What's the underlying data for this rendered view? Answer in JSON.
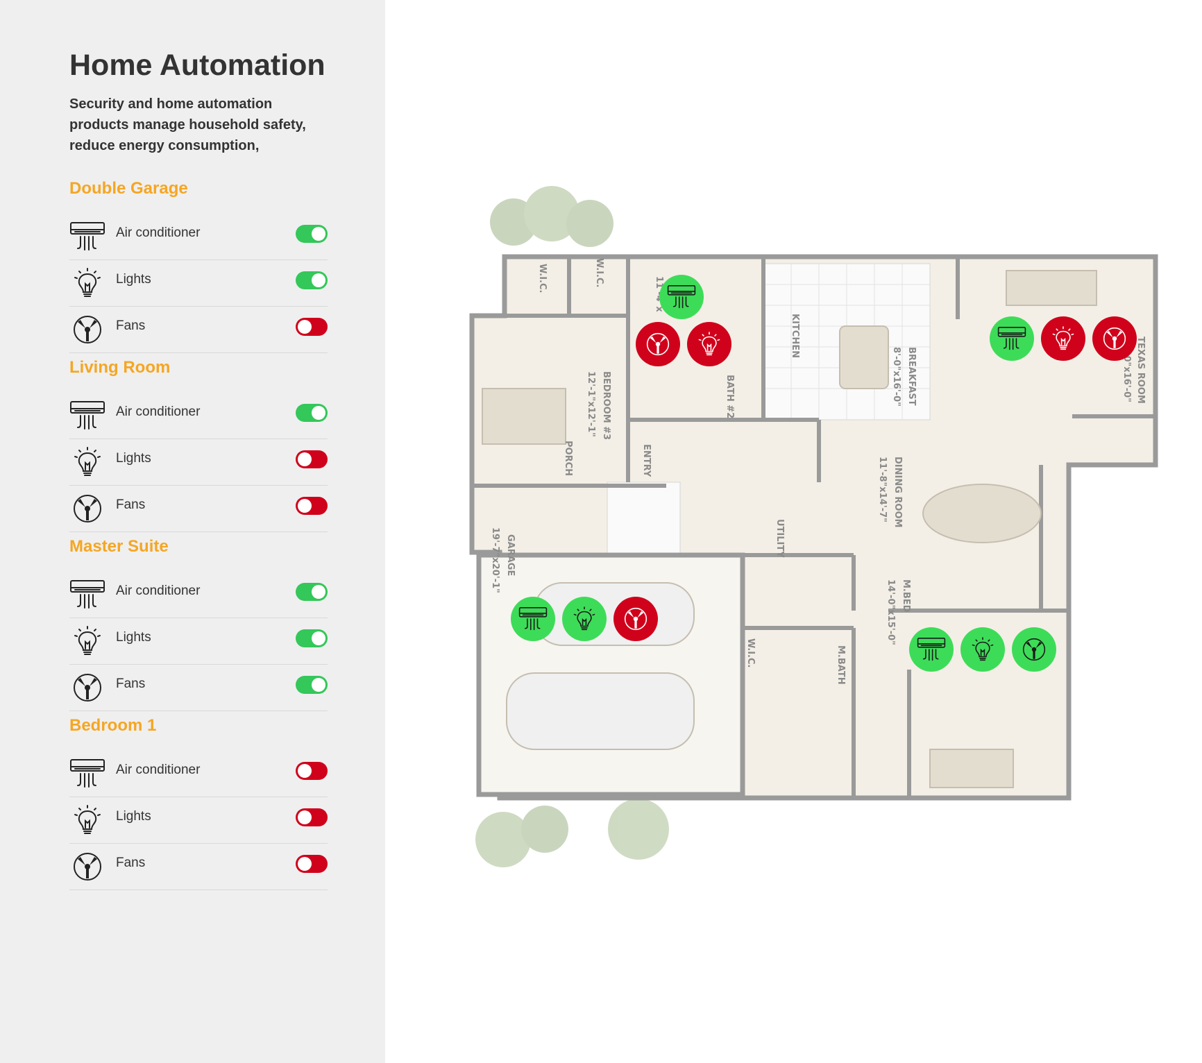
{
  "header": {
    "title": "Home Automation",
    "description": "Security and home automation products manage household safety, reduce energy consumption,"
  },
  "colors": {
    "accent": "#f5a623",
    "on": "#34c759",
    "off": "#d0021b",
    "sidebar_bg": "#efefef"
  },
  "rooms": [
    {
      "name": "Double Garage",
      "devices": [
        {
          "icon": "air-conditioner-icon",
          "label": "Air conditioner",
          "on": true
        },
        {
          "icon": "bulb-icon",
          "label": "Lights",
          "on": true
        },
        {
          "icon": "fan-icon",
          "label": "Fans",
          "on": false
        }
      ]
    },
    {
      "name": "Living Room",
      "devices": [
        {
          "icon": "air-conditioner-icon",
          "label": "Air conditioner",
          "on": true
        },
        {
          "icon": "bulb-icon",
          "label": "Lights",
          "on": false
        },
        {
          "icon": "fan-icon",
          "label": "Fans",
          "on": false
        }
      ]
    },
    {
      "name": "Master Suite",
      "devices": [
        {
          "icon": "air-conditioner-icon",
          "label": "Air conditioner",
          "on": true
        },
        {
          "icon": "bulb-icon",
          "label": "Lights",
          "on": true
        },
        {
          "icon": "fan-icon",
          "label": "Fans",
          "on": true
        }
      ]
    },
    {
      "name": "Bedroom 1",
      "devices": [
        {
          "icon": "air-conditioner-icon",
          "label": "Air conditioner",
          "on": false
        },
        {
          "icon": "bulb-icon",
          "label": "Lights",
          "on": false
        },
        {
          "icon": "fan-icon",
          "label": "Fans",
          "on": false
        }
      ]
    }
  ],
  "floorplan": {
    "labels": {
      "wic1": "W.I.C.",
      "wic2": "W.I.C.",
      "bath2": "BATH #2",
      "kitchen": "KITCHEN",
      "breakfast": "BREAKFAST",
      "breakfast_dim": "8'-0\"x16'-0\"",
      "texas": "TEXAS ROOM",
      "texas_dim": "15'-0\"x16'-0\"",
      "bedroom3": "BEDROOM #3",
      "bedroom3_dim": "12'-1\"x12'-1\"",
      "bed_dim": "11'-4\"x",
      "porch": "PORCH",
      "entry": "ENTRY",
      "dining": "DINING ROOM",
      "dining_dim": "11'-8\"x14'-7\"",
      "utility": "UTILITY",
      "garage": "GARAGE",
      "garage_dim": "19'-7\"x20'-1\"",
      "wic3": "W.I.C.",
      "mbath": "M.BATH",
      "mbed": "M.BED",
      "mbed_dim": "14'-0\"x15'-0\""
    },
    "markers": [
      {
        "name": "bedroom1-ac-marker",
        "icon": "air-conditioner-icon",
        "on": true
      },
      {
        "name": "bedroom1-fan-marker",
        "icon": "fan-icon",
        "on": false
      },
      {
        "name": "bedroom1-lights-marker",
        "icon": "bulb-icon",
        "on": false
      },
      {
        "name": "living-room-ac-marker",
        "icon": "air-conditioner-icon",
        "on": true
      },
      {
        "name": "living-room-lights-marker",
        "icon": "bulb-icon",
        "on": false
      },
      {
        "name": "living-room-fan-marker",
        "icon": "fan-icon",
        "on": false
      },
      {
        "name": "garage-ac-marker",
        "icon": "air-conditioner-icon",
        "on": true
      },
      {
        "name": "garage-lights-marker",
        "icon": "bulb-icon",
        "on": true
      },
      {
        "name": "garage-fan-marker",
        "icon": "fan-icon",
        "on": false
      },
      {
        "name": "master-suite-ac-marker",
        "icon": "air-conditioner-icon",
        "on": true
      },
      {
        "name": "master-suite-lights-marker",
        "icon": "bulb-icon",
        "on": true
      },
      {
        "name": "master-suite-fan-marker",
        "icon": "fan-icon",
        "on": true
      }
    ]
  }
}
